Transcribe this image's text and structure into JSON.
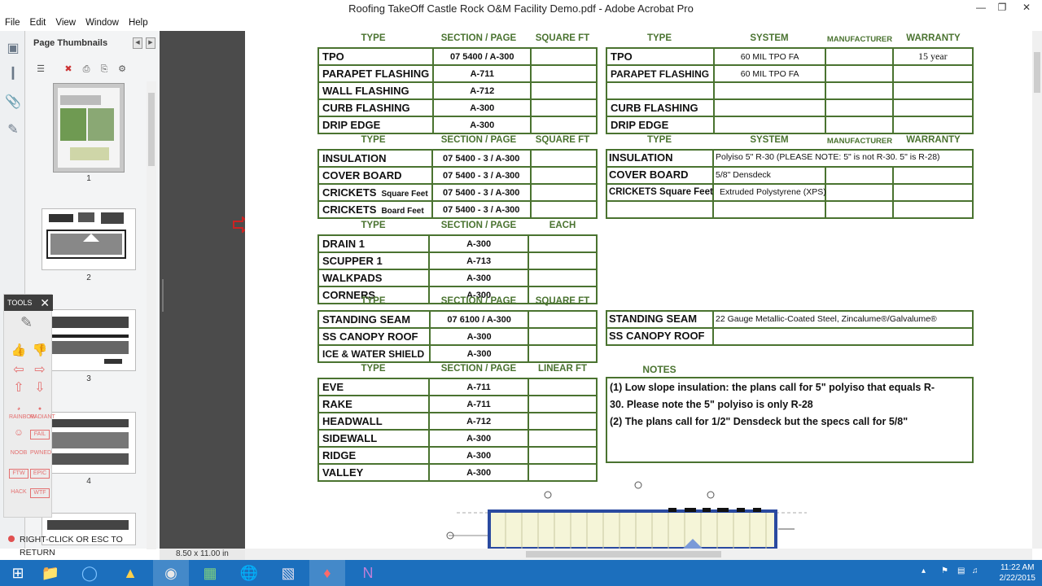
{
  "window": {
    "title": "Roofing TakeOff Castle Rock O&M Facility Demo.pdf - Adobe Acrobat Pro"
  },
  "menu": [
    "File",
    "Edit",
    "View",
    "Window",
    "Help"
  ],
  "thumbnails": {
    "header": "Page Thumbnails",
    "pages": [
      "1",
      "2",
      "3",
      "4"
    ]
  },
  "page_size": "8.50 x 11.00 in",
  "tools_panel": {
    "title": "TOOLS",
    "stamps": [
      "THUMBS UP",
      "THUMBS DOWN",
      "BACKWARD",
      "FORWARD",
      "UP",
      "DOWN",
      "RAINBOW",
      "RADIANT",
      "HAPPY",
      "FAIL",
      "NOOB",
      "PWNED",
      "FTW",
      "EPIC",
      "HACK",
      "WTF"
    ],
    "return_hint": "RIGHT-CLICK OR ESC TO RETURN"
  },
  "sheet": {
    "block1": {
      "headers": [
        "TYPE",
        "SECTION / PAGE",
        "SQUARE FT"
      ],
      "rows": [
        {
          "type": "TPO",
          "section": "07 5400 / A-300"
        },
        {
          "type": "PARAPET FLASHING",
          "section": "A-711"
        },
        {
          "type": "WALL FLASHING",
          "section": "A-712"
        },
        {
          "type": "CURB FLASHING",
          "section": "A-300"
        },
        {
          "type": "DRIP EDGE",
          "section": "A-300"
        }
      ]
    },
    "block1r": {
      "headers": [
        "TYPE",
        "SYSTEM",
        "MANUFACTURER",
        "WARRANTY"
      ],
      "rows": [
        {
          "type": "TPO",
          "system": "60 MIL TPO  FA",
          "warranty": "15 year"
        },
        {
          "type": "PARAPET FLASHING",
          "system": "60 MIL TPO  FA",
          "warranty": ""
        },
        {
          "type": "",
          "system": "",
          "warranty": ""
        },
        {
          "type": "CURB FLASHING",
          "system": "",
          "warranty": ""
        },
        {
          "type": "DRIP EDGE",
          "system": "",
          "warranty": ""
        }
      ]
    },
    "block2": {
      "headers": [
        "TYPE",
        "SECTION / PAGE",
        "SQUARE FT"
      ],
      "rows": [
        {
          "type": "INSULATION",
          "sub": "",
          "section": "07 5400 - 3 / A-300"
        },
        {
          "type": "COVER BOARD",
          "sub": "",
          "section": "07 5400 - 3 / A-300"
        },
        {
          "type": "CRICKETS",
          "sub": "Square Feet",
          "section": "07 5400 - 3 / A-300"
        },
        {
          "type": "CRICKETS",
          "sub": "Board Feet",
          "section": "07 5400 - 3 / A-300"
        }
      ]
    },
    "block2r": {
      "headers": [
        "TYPE",
        "SYSTEM",
        "MANUFACTURER",
        "WARRANTY"
      ],
      "rows": [
        {
          "type": "INSULATION",
          "system": "Polyiso  5\" R-30   (PLEASE NOTE:  5\" is not R-30.  5\" is R-28)"
        },
        {
          "type": "COVER BOARD",
          "system": "5/8\" Densdeck"
        },
        {
          "type": "CRICKETS  Square Feet",
          "system": "Extruded Polystyrene (XPS)"
        },
        {
          "type": "",
          "system": ""
        }
      ]
    },
    "block3": {
      "headers": [
        "TYPE",
        "SECTION / PAGE",
        "EACH"
      ],
      "rows": [
        {
          "type": "DRAIN 1",
          "section": "A-300"
        },
        {
          "type": "SCUPPER 1",
          "section": "A-713"
        },
        {
          "type": "WALKPADS",
          "section": "A-300"
        },
        {
          "type": "CORNERS",
          "section": "A-300"
        }
      ]
    },
    "block4": {
      "headers": [
        "TYPE",
        "SECTION / PAGE",
        "SQUARE FT"
      ],
      "rows": [
        {
          "type": "STANDING SEAM",
          "section": "07 6100 / A-300"
        },
        {
          "type": "SS CANOPY ROOF",
          "section": "A-300"
        },
        {
          "type": "ICE & WATER SHIELD",
          "section": "A-300"
        }
      ]
    },
    "block4r": {
      "rows": [
        {
          "type": "STANDING SEAM",
          "system": "22 Gauge Metallic-Coated Steel, Zincalume®/Galvalume®"
        },
        {
          "type": "SS CANOPY ROOF",
          "system": ""
        }
      ]
    },
    "block5": {
      "headers": [
        "TYPE",
        "SECTION / PAGE",
        "LINEAR FT"
      ],
      "rows": [
        {
          "type": "EVE",
          "section": "A-711"
        },
        {
          "type": "RAKE",
          "section": "A-711"
        },
        {
          "type": "HEADWALL",
          "section": "A-712"
        },
        {
          "type": "SIDEWALL",
          "section": "A-300"
        },
        {
          "type": "RIDGE",
          "section": "A-300"
        },
        {
          "type": "VALLEY",
          "section": "A-300"
        }
      ]
    },
    "notes": {
      "header": "NOTES",
      "line1": "(1) Low slope insulation: the plans call for 5\" polyiso that equals  R-",
      "line2": "30.  Please note the 5\" polyiso is only R-28",
      "line3": "(2) The plans call for 1/2\" Densdeck but the specs call for 5/8\""
    }
  },
  "taskbar": {
    "apps": [
      "start-icon",
      "file-explorer-icon",
      "internet-explorer-icon",
      "google-drive-icon",
      "chrome-icon",
      "spreadsheet-icon",
      "google-earth-icon",
      "calculator-icon",
      "acrobat-icon",
      "onenote-icon"
    ]
  },
  "clock": {
    "time": "11:22 AM",
    "date": "2/22/2015"
  },
  "colors": {
    "grid": "#4a7330",
    "taskbar": "#1c6fbd",
    "gutter": "#4b4b4b"
  }
}
